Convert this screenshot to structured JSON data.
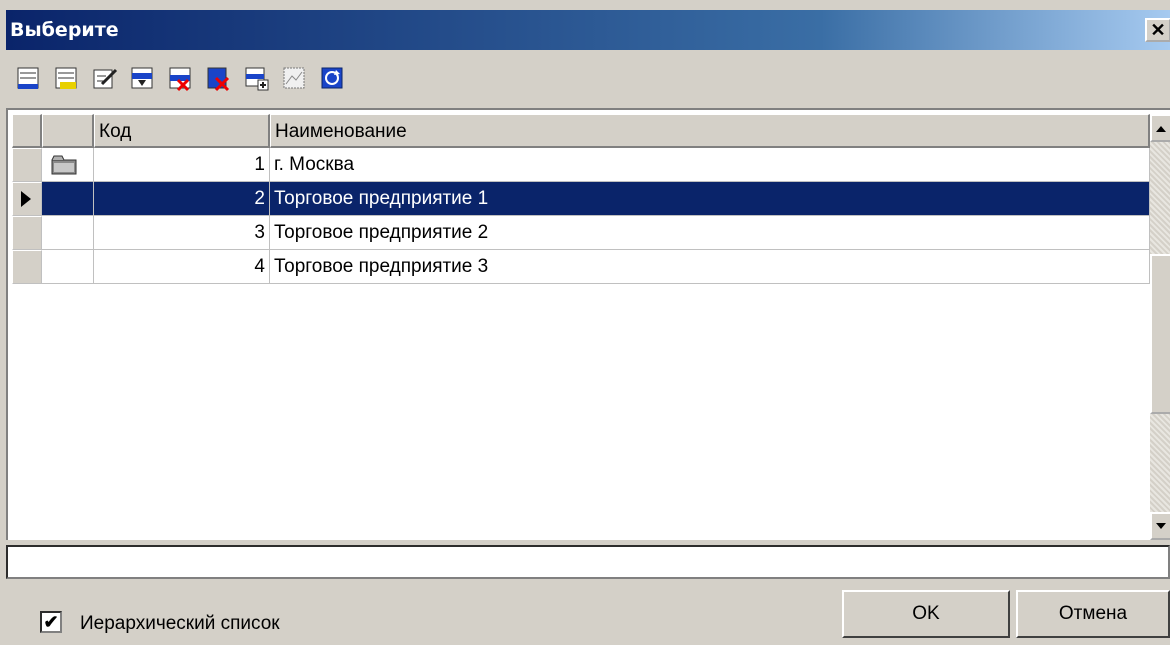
{
  "window": {
    "title": "Выберите",
    "close_label": "✕"
  },
  "toolbar": {
    "buttons": [
      {
        "icon": "add-record-icon"
      },
      {
        "icon": "add-group-icon"
      },
      {
        "icon": "edit-record-icon"
      },
      {
        "icon": "move-into-group-icon"
      },
      {
        "icon": "delete-mark-icon"
      },
      {
        "icon": "delete-record-icon"
      },
      {
        "icon": "copy-record-icon"
      },
      {
        "icon": "filter-icon"
      },
      {
        "icon": "refresh-icon"
      }
    ]
  },
  "grid": {
    "columns": {
      "code": "Код",
      "name": "Наименование"
    },
    "rows": [
      {
        "code": "1",
        "name": "г. Москва",
        "is_group": true,
        "selected": false
      },
      {
        "code": "2",
        "name": "Торговое предприятие 1",
        "is_group": false,
        "selected": true
      },
      {
        "code": "3",
        "name": "Торговое предприятие 2",
        "is_group": false,
        "selected": false
      },
      {
        "code": "4",
        "name": "Торговое предприятие 3",
        "is_group": false,
        "selected": false
      }
    ]
  },
  "filter": {
    "value": ""
  },
  "hierarchy_checkbox": {
    "label": "Иерархический список",
    "checked": true,
    "mark": "✔"
  },
  "buttons": {
    "ok": "OK",
    "cancel": "Отмена"
  },
  "colors": {
    "selection": "#0a246a",
    "title_start": "#0a246a",
    "title_end": "#a6caf0"
  }
}
